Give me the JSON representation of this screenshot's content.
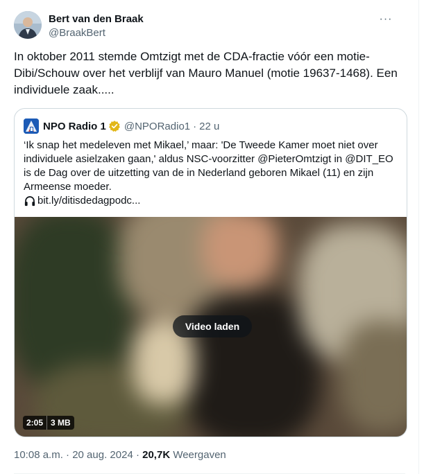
{
  "tweet": {
    "author_name": "Bert van den Braak",
    "author_handle": "@BraakBert",
    "more_label": "···",
    "text": "In oktober 2011 stemde Omtzigt met de CDA-fractie vóór een motie-Dibi/Schouw over het verblijf van Mauro Manuel (motie 19637-1468). Een individuele zaak.....",
    "timestamp": "10:08 a.m. · 20 aug. 2024 ·",
    "views_count": "20,7K",
    "views_label": "Weergaven"
  },
  "quote": {
    "name": "NPO Radio 1",
    "handle": "@NPORadio1",
    "separator": "·",
    "time": "22 u",
    "text": "‘Ik snap het medeleven met Mikael,’ maar: 'De Tweede Kamer moet niet over individuele asielzaken gaan,' aldus NSC-voorzitter @PieterOmtzigt in @DIT_EO is de Dag over de uitzetting van de in Nederland geboren Mikael (11) en zijn Armeense moeder.",
    "link": "bit.ly/ditisdedagpodc...",
    "video_button": "Video laden",
    "duration": "2:05",
    "size": "3 MB"
  },
  "icons": {
    "avatar": "avatar",
    "logo": "npo-radio-1-logo",
    "verified": "verified-badge-gold",
    "headphones": "headphones-icon"
  },
  "colors": {
    "text": "#0f1419",
    "secondary": "#536471",
    "border": "#cfd9de",
    "verified_gold": "#e2b719"
  }
}
